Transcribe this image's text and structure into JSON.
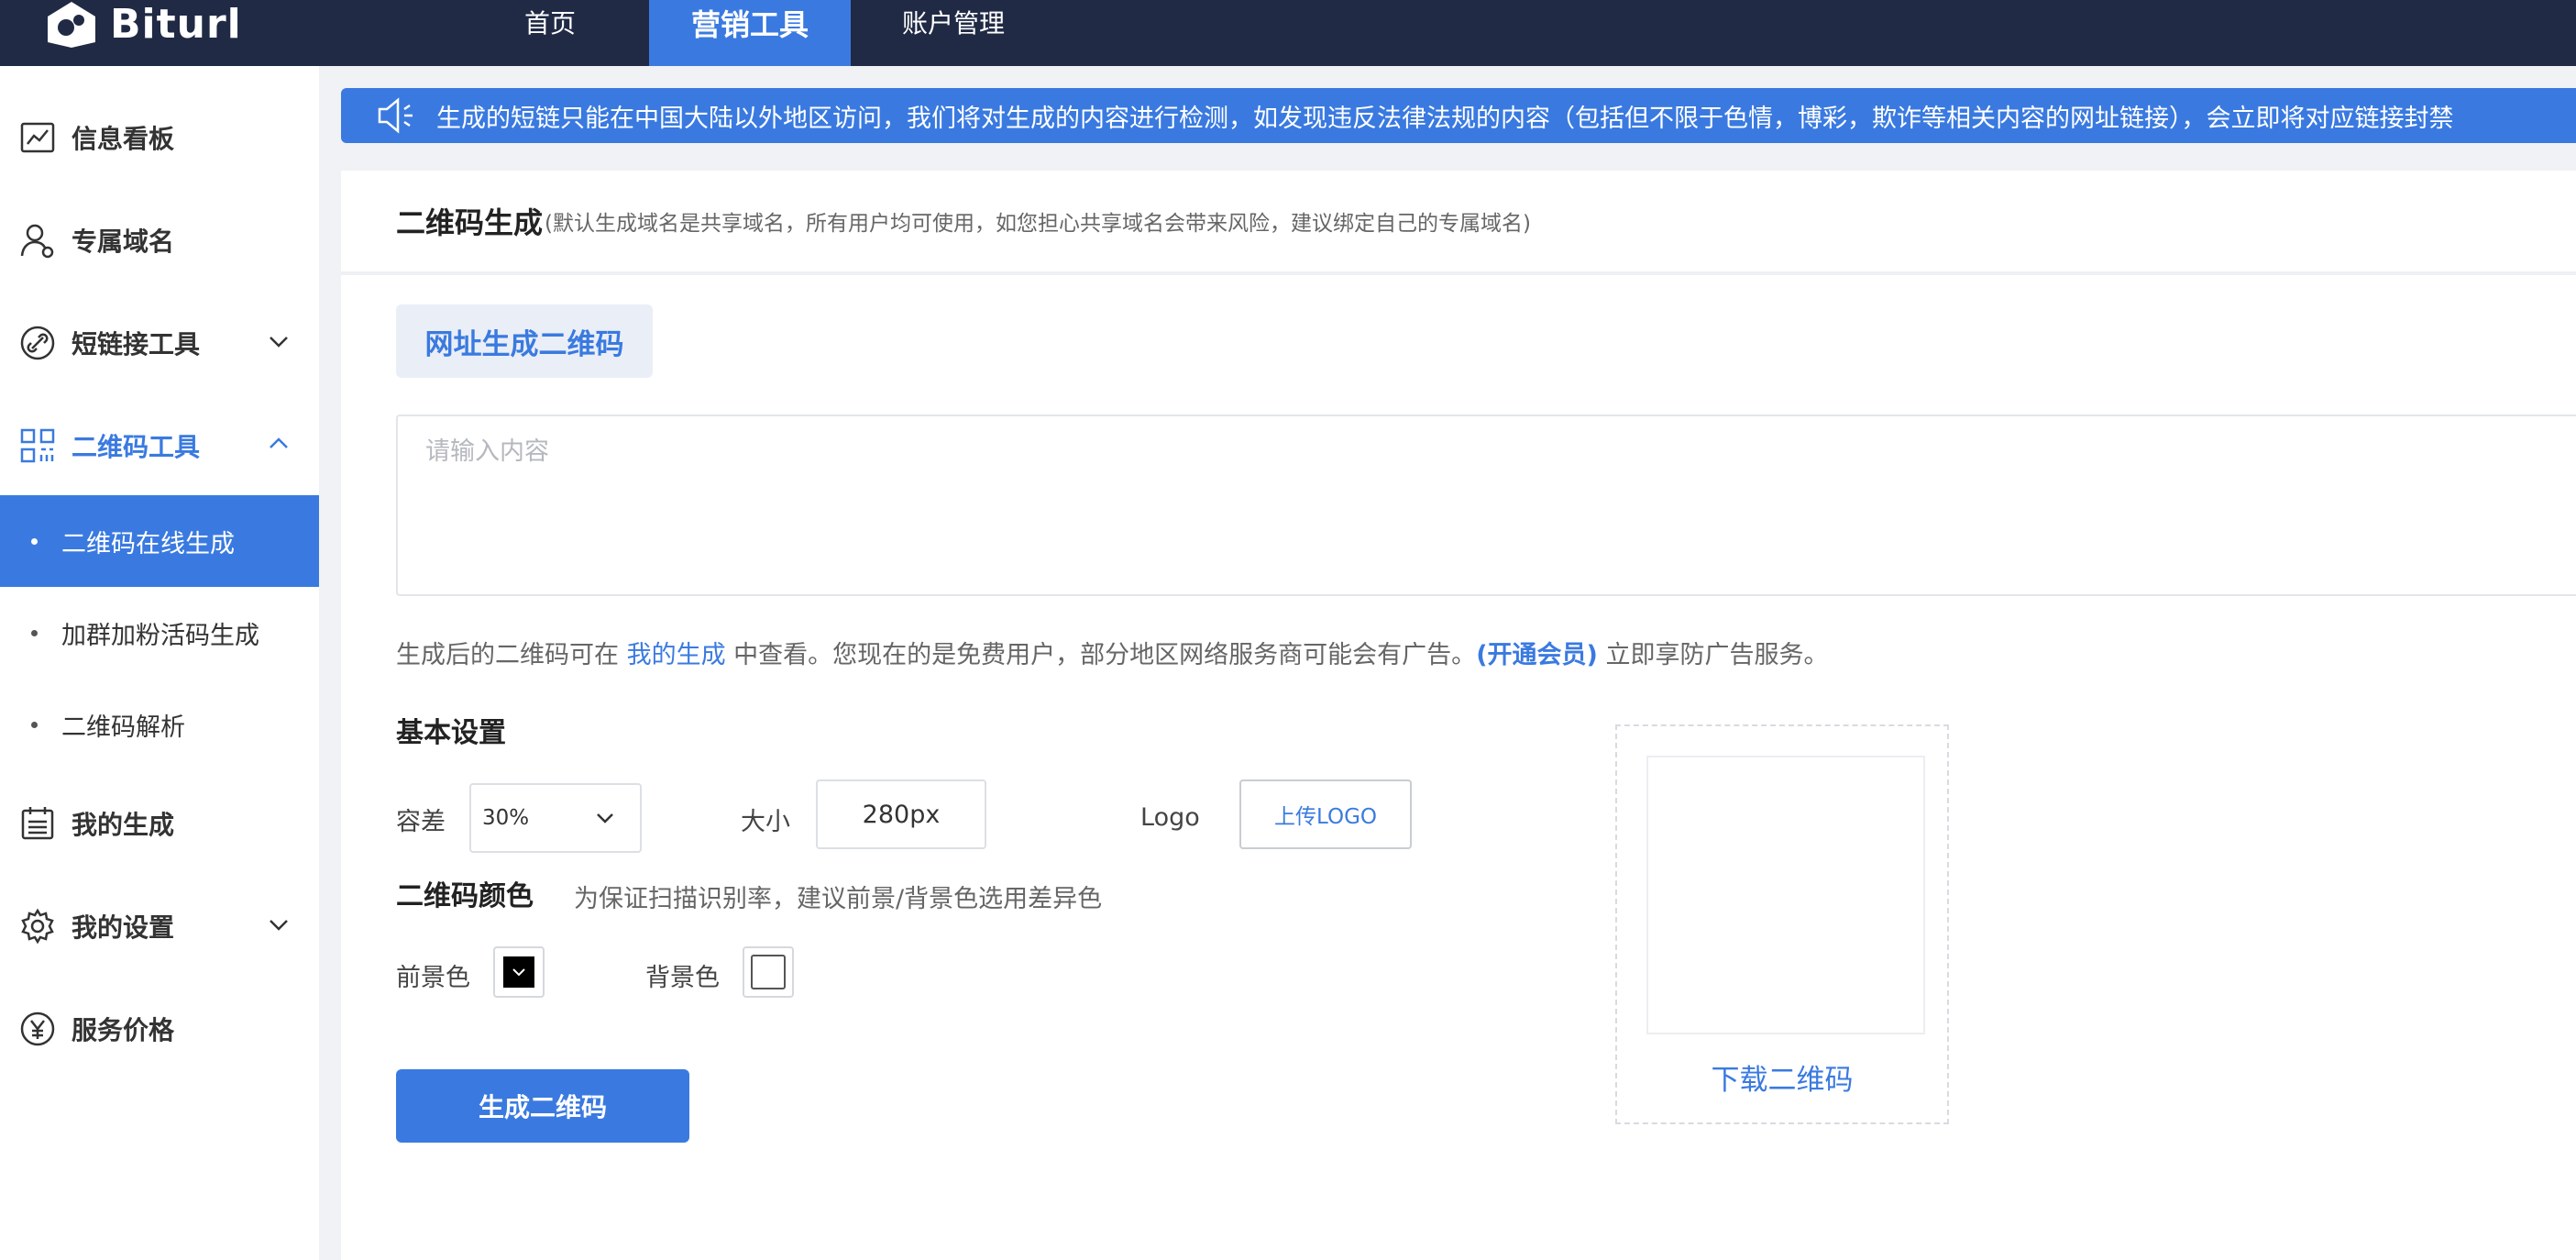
{
  "app": {
    "logo_text": "Biturl"
  },
  "topnav": {
    "home": "首页",
    "marketing": "营销工具",
    "account": "账户管理"
  },
  "sidebar": {
    "dashboard": "信息看板",
    "domain": "专属域名",
    "shortlink": "短链接工具",
    "qrcode": "二维码工具",
    "qr_sub": [
      "二维码在线生成",
      "加群加粉活码生成",
      "二维码解析"
    ],
    "my_gen": "我的生成",
    "settings": "我的设置",
    "pricing": "服务价格"
  },
  "notice": {
    "icon": "speaker-icon",
    "text": "生成的短链只能在中国大陆以外地区访问，我们将对生成的内容进行检测，如发现违反法律法规的内容（包括但不限于色情，博彩，欺诈等相关内容的网址链接），会立即将对应链接封禁"
  },
  "card": {
    "title": "二维码生成",
    "subtitle": "(默认生成域名是共享域名，所有用户均可使用，如您担心共享域名会带来风险，建议绑定自己的专属域名)",
    "tab": "网址生成二维码",
    "input_placeholder": "请输入内容"
  },
  "hint": {
    "pre": "生成后的二维码可在 ",
    "link": "我的生成",
    "mid": " 中查看。您现在的是免费用户，部分地区网络服务商可能会有广告。",
    "vip": "(开通会员)",
    "post": " 立即享防广告服务。"
  },
  "basic": {
    "title": "基本设置",
    "tolerance_label": "容差",
    "tolerance_value": "30%",
    "size_label": "大小",
    "size_value": "280px",
    "logo_label": "Logo",
    "upload_label": "上传LOGO"
  },
  "color": {
    "title": "二维码颜色",
    "note": "为保证扫描识别率，建议前景/背景色选用差异色",
    "fg_label": "前景色",
    "bg_label": "背景色",
    "fg_color": "#000000",
    "bg_color": "#ffffff"
  },
  "actions": {
    "generate": "生成二维码",
    "download": "下载二维码"
  },
  "colors": {
    "nav_bg": "#202a45",
    "accent": "#3a7ae0"
  }
}
